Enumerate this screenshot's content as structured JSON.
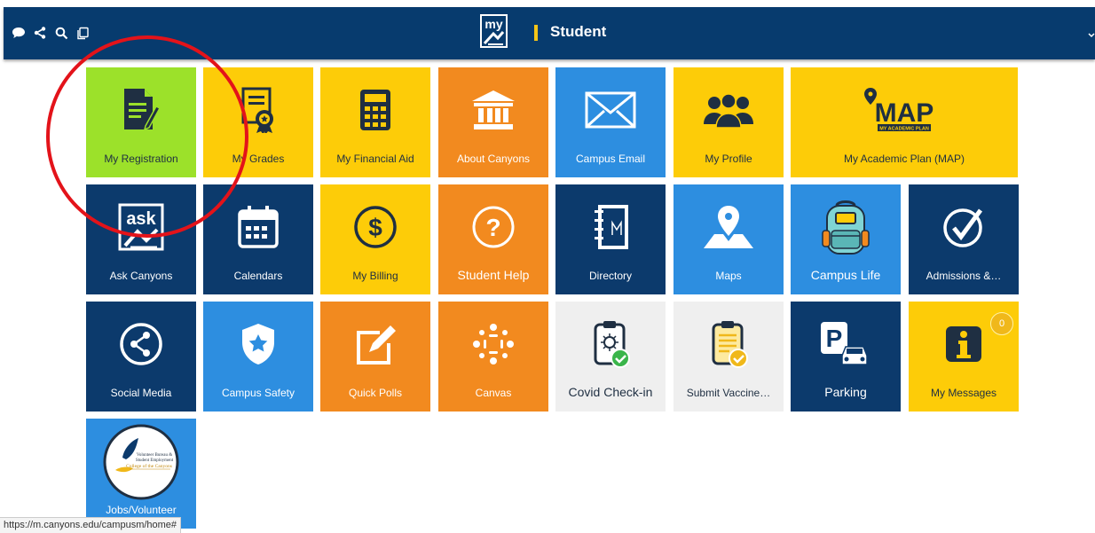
{
  "header": {
    "title": "Student",
    "logo_text": "my",
    "icons": [
      "chat-icon",
      "share-icon",
      "search-icon",
      "copy-icon"
    ]
  },
  "tiles": [
    {
      "label": "My Registration"
    },
    {
      "label": "My Grades"
    },
    {
      "label": "My Financial Aid"
    },
    {
      "label": "About Canyons"
    },
    {
      "label": "Campus Email"
    },
    {
      "label": "My Profile"
    },
    {
      "label": "My Academic Plan (MAP)",
      "logo_text": "MAP",
      "logo_sub": "MY ACADEMIC PLAN"
    },
    {
      "label": "Ask Canyons",
      "icon_text": "ask"
    },
    {
      "label": "Calendars"
    },
    {
      "label": "My Billing"
    },
    {
      "label": "Student Help"
    },
    {
      "label": "Directory"
    },
    {
      "label": "Maps"
    },
    {
      "label": "Campus Life"
    },
    {
      "label": "Admissions &…"
    },
    {
      "label": "Social Media"
    },
    {
      "label": "Campus Safety"
    },
    {
      "label": "Quick Polls"
    },
    {
      "label": "Canvas"
    },
    {
      "label": "Covid Check-in"
    },
    {
      "label": "Submit Vaccine…"
    },
    {
      "label": "Parking"
    },
    {
      "label": "My Messages",
      "badge": "0"
    },
    {
      "label": "Jobs/Volunteer",
      "logo_line1": "Volunteer Bureau &",
      "logo_line2": "Student Employment",
      "logo_line3": "College of the Canyons"
    }
  ],
  "status_url": "https://m.canyons.edu/campusm/home#",
  "colors": {
    "navy": "#0c3a6c",
    "yellow": "#fdcc08",
    "orange": "#f28a1f",
    "blue": "#2d8ee0",
    "lime": "#9ce12a",
    "annotation": "#e3131a"
  }
}
